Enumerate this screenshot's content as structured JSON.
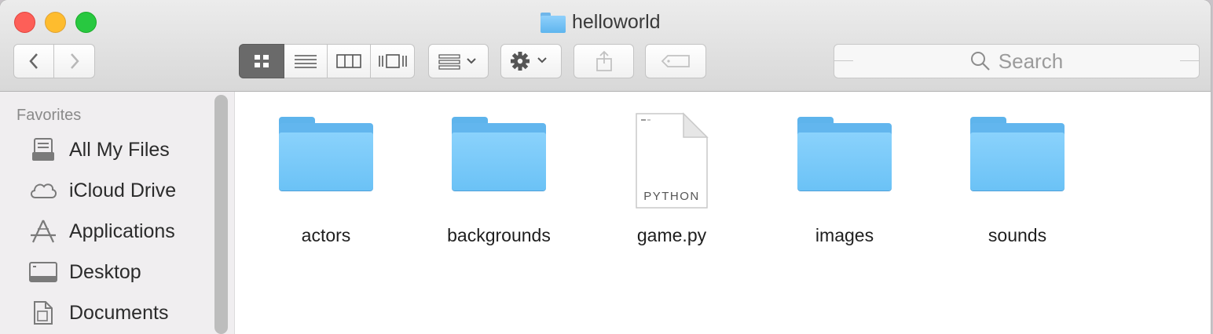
{
  "window": {
    "title": "helloworld"
  },
  "toolbar": {
    "back_icon": "chevron-left-icon",
    "forward_icon": "chevron-right-icon",
    "view_modes": [
      "icon-view",
      "list-view",
      "column-view",
      "cover-flow-view"
    ],
    "active_view": "icon-view",
    "arrange_icon": "arrange-grid-icon",
    "action_icon": "gear-icon",
    "share_icon": "share-icon",
    "tag_icon": "tag-icon",
    "search_placeholder": "Search"
  },
  "sidebar": {
    "heading": "Favorites",
    "items": [
      {
        "label": "All My Files",
        "icon": "all-files-icon"
      },
      {
        "label": "iCloud Drive",
        "icon": "cloud-icon"
      },
      {
        "label": "Applications",
        "icon": "applications-icon"
      },
      {
        "label": "Desktop",
        "icon": "desktop-icon"
      },
      {
        "label": "Documents",
        "icon": "documents-icon"
      }
    ]
  },
  "files": [
    {
      "name": "actors",
      "kind": "folder"
    },
    {
      "name": "backgrounds",
      "kind": "folder"
    },
    {
      "name": "game.py",
      "kind": "python-file",
      "badge": "PYTHON"
    },
    {
      "name": "images",
      "kind": "folder"
    },
    {
      "name": "sounds",
      "kind": "folder"
    }
  ],
  "colors": {
    "close": "#fd5f58",
    "minimize": "#febc2e",
    "maximize": "#28c840",
    "folder": "#6bc2f6"
  }
}
